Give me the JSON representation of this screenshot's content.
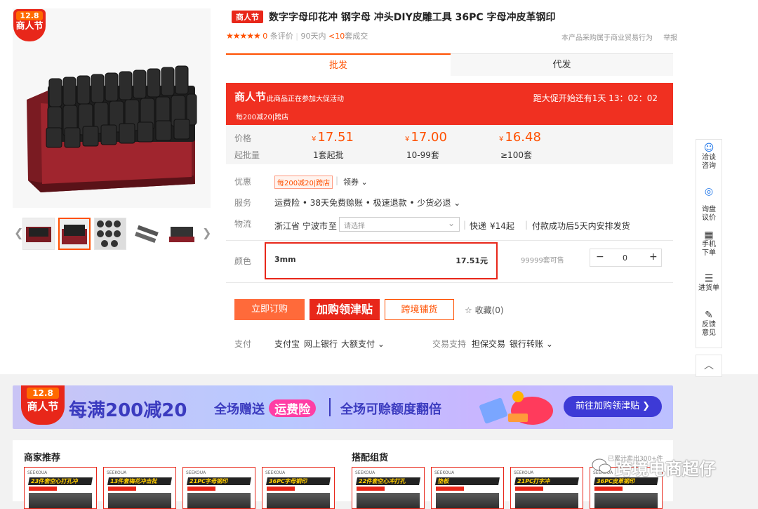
{
  "product": {
    "badge_date": "12.8",
    "badge_text": "商人节",
    "title_tag": "商人节",
    "title": "数字字母印花冲 钢字母 冲头DIY皮雕工具 36PC 字母冲皮革钢印",
    "stars": "★★★★★",
    "review_count": "0",
    "review_label": "条评价",
    "sales_period": "90天内",
    "sales_count": "<10",
    "sales_unit": "套成交",
    "trade_note": "本产品采购属于商业贸易行为",
    "report": "举报"
  },
  "tabs": {
    "wholesale": "批发",
    "dropship": "代发"
  },
  "promo": {
    "tag": "商人节",
    "subtitle": "此商品正在参加大促活动",
    "countdown": "距大促开始还有1天 13：02：02",
    "coupon": "每200减20|跨店"
  },
  "prices": {
    "price_label": "价格",
    "moq_label": "起批量",
    "currency": "¥",
    "tiers": [
      {
        "price": "17.51",
        "qty": "1套起批"
      },
      {
        "price": "17.00",
        "qty": "10-99套"
      },
      {
        "price": "16.48",
        "qty": "≥100套"
      }
    ]
  },
  "discount": {
    "label": "优惠",
    "tag": "每200减20|跨店",
    "coupon": "领券"
  },
  "service": {
    "label": "服务",
    "text": "运费险 • 38天免费赊账 • 极速退款 • 少货必退"
  },
  "logistics": {
    "label": "物流",
    "origin": "浙江省 宁波市",
    "to": "至",
    "dest_placeholder": "请选择",
    "express": "快递",
    "fee": "¥14起",
    "ship_note": "付款成功后5天内安排发货"
  },
  "color": {
    "label": "颜色",
    "option": "3mm",
    "option_price": "17.51元",
    "stock": "99999套可售",
    "qty": "0",
    "minus": "−",
    "plus": "+"
  },
  "actions": {
    "order": "立即订购",
    "cart": "加购领津贴",
    "cross": "跨境铺货",
    "favorite_icon": "☆",
    "favorite": "收藏(0)"
  },
  "payment": {
    "label": "支付",
    "methods": [
      "支付宝",
      "网上银行",
      "大额支付"
    ],
    "trade_label": "交易支持",
    "trade_methods": [
      "担保交易",
      "银行转账"
    ]
  },
  "sidebar": {
    "items": [
      {
        "icon": "chat-icon",
        "glyph": "☺",
        "label1": "洽谈",
        "label2": "咨询"
      },
      {
        "icon": "target-icon",
        "glyph": "◎",
        "label1": "询盘",
        "label2": "议价"
      },
      {
        "icon": "qrcode-icon",
        "glyph": "▦",
        "label1": "手机",
        "label2": "下单"
      },
      {
        "icon": "list-icon",
        "glyph": "☰",
        "label1": "进货单",
        "label2": ""
      },
      {
        "icon": "edit-icon",
        "glyph": "✎",
        "label1": "反馈",
        "label2": "意见"
      }
    ],
    "top": "︿"
  },
  "banner": {
    "date": "12.8",
    "tag": "商人节",
    "main": "每满200减20",
    "mid_text": "全场赠送",
    "mid_pill": "运费险",
    "right": "全场可赊额度翻倍",
    "button": "前往加购领津贴 ❯"
  },
  "recommend": {
    "left_title": "商家推荐",
    "right_title": "搭配组货",
    "sold": "已累计卖出300+件",
    "left_cards": [
      "23件套空心打孔冲",
      "13件套梅花冲击批",
      "21PC字母钢印",
      "36PC字母钢印"
    ],
    "right_cards": [
      "22件套空心冲打孔",
      "垫板",
      "21PC打字冲",
      "36PC皮革钢印"
    ],
    "brand": "SEEKOUA"
  },
  "watermark": "跨境电商超仔"
}
